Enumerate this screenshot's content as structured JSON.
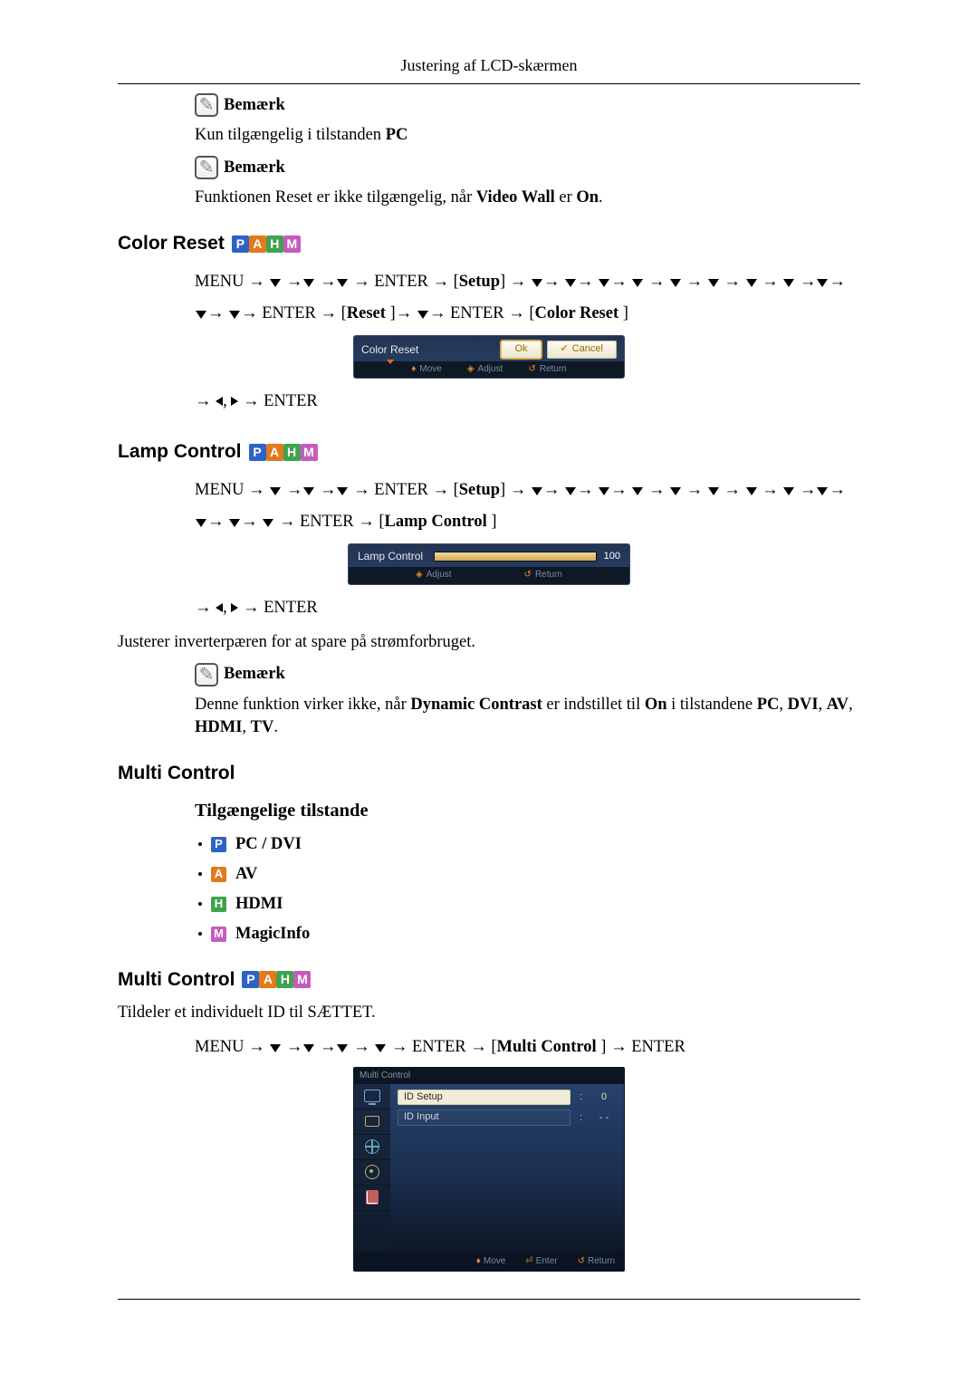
{
  "header": {
    "title": "Justering af LCD-skærmen"
  },
  "note_label": "Bemærk",
  "note1_text": {
    "prefix": "Kun tilgængelig i tilstanden ",
    "bold": "PC"
  },
  "note2_text": {
    "prefix": "Funktionen Reset er ikke tilgængelig, når ",
    "bold": "Video Wall",
    "mid": " er ",
    "bold2": "On",
    "suffix": "."
  },
  "section_colorreset": "Color Reset",
  "nav_colorreset": {
    "tokens": [
      "MENU",
      "→",
      "▼",
      "→",
      "▼",
      "→",
      "▼",
      "→",
      "ENTER",
      "→",
      "[",
      "Setup",
      "]",
      "→",
      "▼",
      "→",
      "▼",
      "→",
      "▼",
      "→",
      "▼",
      "→",
      "▼",
      "→",
      "▼",
      "→",
      "▼",
      "→",
      "▼",
      "→",
      "▼",
      "→",
      "▼",
      "→",
      "▼",
      "→",
      "ENTER",
      "→",
      "[",
      "Reset",
      "]",
      "→",
      "▼",
      "→",
      "ENTER",
      "→",
      "[",
      "Color Reset",
      "]"
    ]
  },
  "osd_colorreset": {
    "title": "Color Reset",
    "ok": "Ok",
    "cancel": "Cancel",
    "hints": [
      "Move",
      "Adjust",
      "Return"
    ]
  },
  "nav_enter_line": {
    "tokens": [
      "→",
      "◄",
      ",",
      "►",
      "→",
      "ENTER"
    ]
  },
  "section_lamp": "Lamp Control",
  "nav_lamp": {
    "tokens": [
      "MENU",
      "→",
      "▼",
      "→",
      "▼",
      "→",
      "▼",
      "→",
      "ENTER",
      "→",
      "[",
      "Setup",
      "]",
      "→",
      "▼",
      "→",
      "▼",
      "→",
      "▼",
      "→",
      "▼",
      "→",
      "▼",
      "→",
      "▼",
      "→",
      "▼",
      "→",
      "▼",
      "→",
      "▼",
      "→",
      "▼",
      "→",
      "▼",
      "→",
      "▼",
      "→",
      "ENTER",
      "→",
      "[",
      "Lamp Control",
      "]"
    ]
  },
  "osd_lamp": {
    "title": "Lamp Control",
    "value": "100",
    "hints": [
      "Adjust",
      "Return"
    ]
  },
  "lamp_desc": "Justerer inverterpæren for at spare på strømforbruget.",
  "note3_text": {
    "prefix": "Denne funktion virker ikke, når ",
    "b1": "Dynamic Contrast",
    "mid1": " er indstillet til ",
    "b2": "On",
    "mid2": " i tilstandene ",
    "b3": "PC",
    "sep": ", ",
    "b4": "DVI",
    "b5": "AV",
    "b6": "HDMI",
    "b7": "TV",
    "suffix": "."
  },
  "section_multi": "Multi Control",
  "sub_modes": "Tilgængelige tilstande",
  "modes": {
    "pc": "PC / DVI",
    "av": "AV",
    "hdmi": "HDMI",
    "magic": "MagicInfo"
  },
  "section_multi2": "Multi Control",
  "multi_desc": "Tildeler et individuelt ID til SÆTTET.",
  "nav_multi": {
    "tokens": [
      "MENU",
      "→",
      "▼",
      "→",
      "▼",
      "→",
      "▼",
      "→",
      "▼",
      "→",
      "ENTER",
      "→",
      "[",
      "Multi Control",
      "]",
      "→",
      "ENTER"
    ]
  },
  "osd_multi": {
    "title": "Multi Control",
    "rows": [
      {
        "label": "ID Setup",
        "value": "0",
        "selected": true
      },
      {
        "label": "ID Input",
        "value": "- -",
        "selected": false
      }
    ],
    "hints": [
      "Move",
      "Enter",
      "Return"
    ]
  }
}
